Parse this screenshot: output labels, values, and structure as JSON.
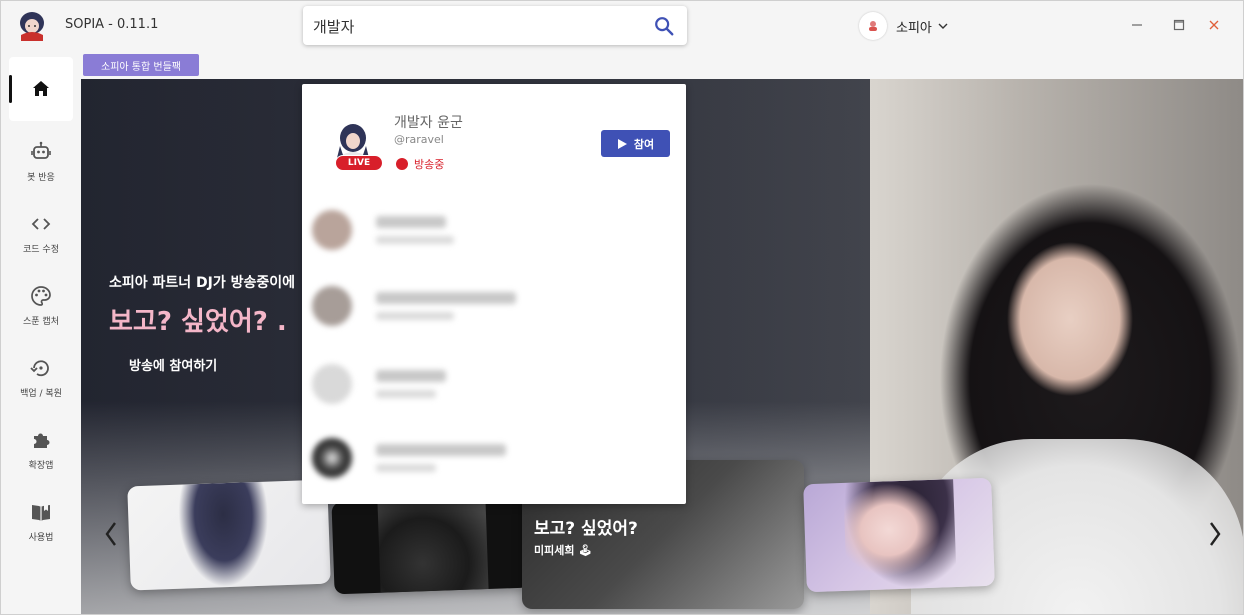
{
  "app": {
    "title": "SOPIA - 0.11.1"
  },
  "search": {
    "value": "개발자",
    "placeholder": ""
  },
  "account": {
    "name": "소피아"
  },
  "sidebar": {
    "items": [
      {
        "label": "",
        "icon": "home-icon"
      },
      {
        "label": "봇 반응",
        "icon": "robot-icon"
      },
      {
        "label": "코드 수정",
        "icon": "code-icon"
      },
      {
        "label": "스푼 캡처",
        "icon": "palette-icon"
      },
      {
        "label": "백업 / 복원",
        "icon": "restore-icon"
      },
      {
        "label": "확장앱",
        "icon": "puzzle-icon"
      },
      {
        "label": "사용법",
        "icon": "book-icon"
      }
    ]
  },
  "badge": {
    "label": "소피아 통합 번들팩"
  },
  "hero": {
    "subtitle": "소피아 파트너 DJ가 방송중이에",
    "title": "보고? 싶었어? .",
    "join_label": "방송에 참여하기"
  },
  "carousel": {
    "featured": {
      "title": "보고? 싶었어?",
      "subtitle": "미피세희 🕹"
    }
  },
  "dropdown": {
    "top_result": {
      "name": "개발자 윤군",
      "tag": "@raravel",
      "live_label": "LIVE",
      "onair_label": "방송중",
      "join_label": "참여"
    }
  },
  "colors": {
    "accent": "#3f51b5",
    "live": "#d81f2a",
    "badge": "#8a7cd6",
    "hero_title": "#f4b6c8"
  }
}
